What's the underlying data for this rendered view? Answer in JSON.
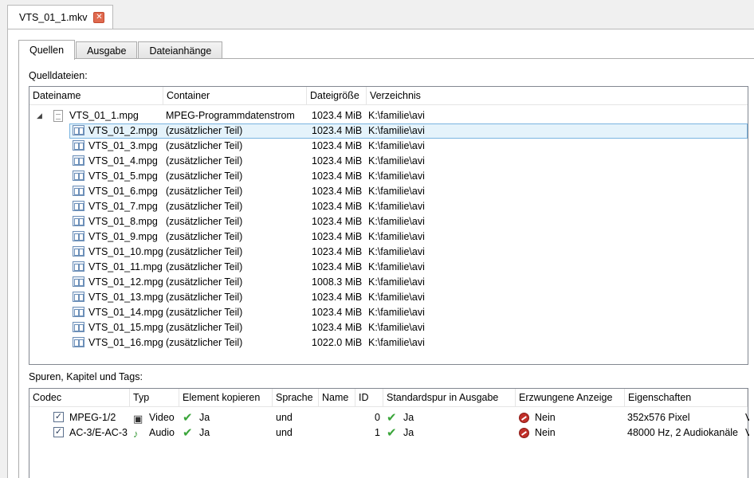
{
  "doc_tab": {
    "title": "VTS_01_1.mkv",
    "close": "✕"
  },
  "tabs": [
    {
      "label": "Quellen",
      "active": true
    },
    {
      "label": "Ausgabe",
      "active": false
    },
    {
      "label": "Dateianhänge",
      "active": false
    }
  ],
  "sources": {
    "label": "Quelldateien:",
    "columns": [
      "Dateiname",
      "Container",
      "Dateigröße",
      "Verzeichnis"
    ],
    "rows": [
      {
        "name": "VTS_01_1.mpg",
        "container": "MPEG-Programmdatenstrom",
        "size": "1023.4 MiB",
        "dir": "K:\\familie\\avi",
        "level": 0
      },
      {
        "name": "VTS_01_2.mpg",
        "container": "(zusätzlicher Teil)",
        "size": "1023.4 MiB",
        "dir": "K:\\familie\\avi",
        "level": 1,
        "selected": true
      },
      {
        "name": "VTS_01_3.mpg",
        "container": "(zusätzlicher Teil)",
        "size": "1023.4 MiB",
        "dir": "K:\\familie\\avi",
        "level": 1
      },
      {
        "name": "VTS_01_4.mpg",
        "container": "(zusätzlicher Teil)",
        "size": "1023.4 MiB",
        "dir": "K:\\familie\\avi",
        "level": 1
      },
      {
        "name": "VTS_01_5.mpg",
        "container": "(zusätzlicher Teil)",
        "size": "1023.4 MiB",
        "dir": "K:\\familie\\avi",
        "level": 1
      },
      {
        "name": "VTS_01_6.mpg",
        "container": "(zusätzlicher Teil)",
        "size": "1023.4 MiB",
        "dir": "K:\\familie\\avi",
        "level": 1
      },
      {
        "name": "VTS_01_7.mpg",
        "container": "(zusätzlicher Teil)",
        "size": "1023.4 MiB",
        "dir": "K:\\familie\\avi",
        "level": 1
      },
      {
        "name": "VTS_01_8.mpg",
        "container": "(zusätzlicher Teil)",
        "size": "1023.4 MiB",
        "dir": "K:\\familie\\avi",
        "level": 1
      },
      {
        "name": "VTS_01_9.mpg",
        "container": "(zusätzlicher Teil)",
        "size": "1023.4 MiB",
        "dir": "K:\\familie\\avi",
        "level": 1
      },
      {
        "name": "VTS_01_10.mpg",
        "container": "(zusätzlicher Teil)",
        "size": "1023.4 MiB",
        "dir": "K:\\familie\\avi",
        "level": 1
      },
      {
        "name": "VTS_01_11.mpg",
        "container": "(zusätzlicher Teil)",
        "size": "1023.4 MiB",
        "dir": "K:\\familie\\avi",
        "level": 1
      },
      {
        "name": "VTS_01_12.mpg",
        "container": "(zusätzlicher Teil)",
        "size": "1008.3 MiB",
        "dir": "K:\\familie\\avi",
        "level": 1
      },
      {
        "name": "VTS_01_13.mpg",
        "container": "(zusätzlicher Teil)",
        "size": "1023.4 MiB",
        "dir": "K:\\familie\\avi",
        "level": 1
      },
      {
        "name": "VTS_01_14.mpg",
        "container": "(zusätzlicher Teil)",
        "size": "1023.4 MiB",
        "dir": "K:\\familie\\avi",
        "level": 1
      },
      {
        "name": "VTS_01_15.mpg",
        "container": "(zusätzlicher Teil)",
        "size": "1023.4 MiB",
        "dir": "K:\\familie\\avi",
        "level": 1
      },
      {
        "name": "VTS_01_16.mpg",
        "container": "(zusätzlicher Teil)",
        "size": "1022.0 MiB",
        "dir": "K:\\familie\\avi",
        "level": 1
      }
    ]
  },
  "tracks": {
    "label": "Spuren, Kapitel und Tags:",
    "columns": [
      "Codec",
      "Typ",
      "Element kopieren",
      "Sprache",
      "Name",
      "ID",
      "Standardspur in Ausgabe",
      "Erzwungene Anzeige",
      "Eigenschaften"
    ],
    "rows": [
      {
        "codec": "MPEG-1/2",
        "type": "Video",
        "type_icon": "video-icon",
        "copy": "Ja",
        "language": "und",
        "name": "",
        "id": "0",
        "default": "Ja",
        "forced": "Nein",
        "properties": "352x576 Pixel",
        "overflow": "V",
        "checked": true
      },
      {
        "codec": "AC-3/E-AC-3",
        "type": "Audio",
        "type_icon": "audio-icon",
        "copy": "Ja",
        "language": "und",
        "name": "",
        "id": "1",
        "default": "Ja",
        "forced": "Nein",
        "properties": "48000 Hz, 2 Audiokanäle",
        "overflow": "V",
        "checked": true
      }
    ]
  }
}
